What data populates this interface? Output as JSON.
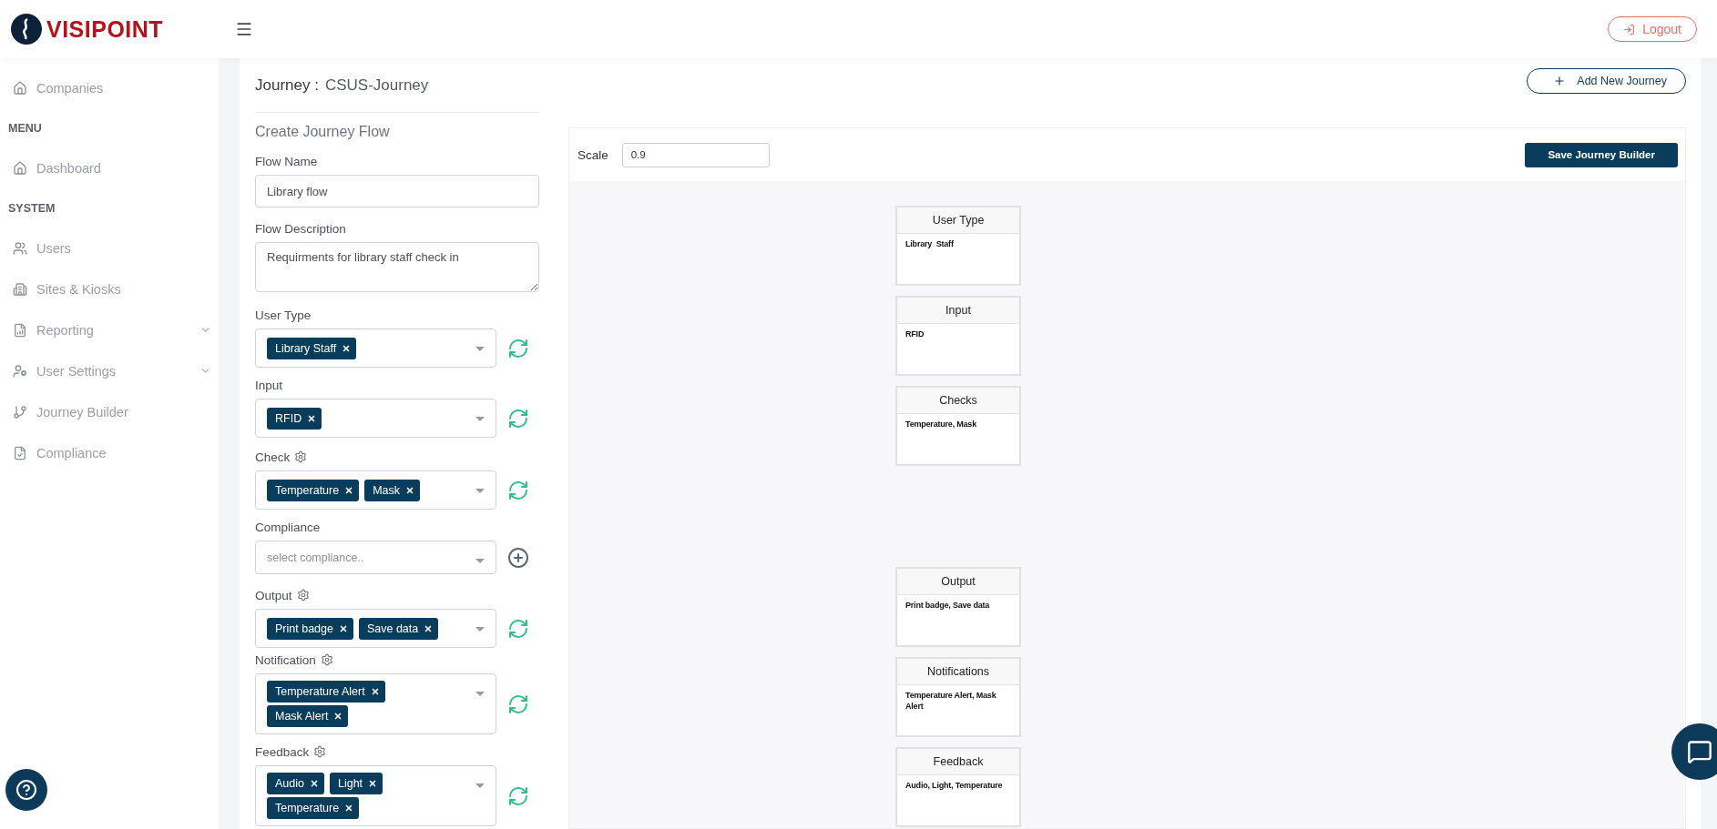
{
  "header": {
    "logo_text": "VISIPOINT",
    "logout": "Logout"
  },
  "sidebar": {
    "items": [
      {
        "kind": "link",
        "label": "Companies"
      },
      {
        "kind": "section",
        "label": "MENU"
      },
      {
        "kind": "link",
        "label": "Dashboard"
      },
      {
        "kind": "section",
        "label": "SYSTEM"
      },
      {
        "kind": "link",
        "label": "Users"
      },
      {
        "kind": "link",
        "label": "Sites & Kiosks"
      },
      {
        "kind": "link",
        "label": "Reporting",
        "expandable": true
      },
      {
        "kind": "link",
        "label": "User Settings",
        "expandable": true
      },
      {
        "kind": "link",
        "label": "Journey Builder"
      },
      {
        "kind": "link",
        "label": "Compliance"
      }
    ]
  },
  "journey": {
    "label": "Journey :",
    "name": "CSUS-Journey",
    "add_button": "Add New Journey"
  },
  "form": {
    "title": "Create Journey Flow",
    "fields": [
      {
        "kind": "text",
        "label": "Flow Name",
        "value": "Library flow"
      },
      {
        "kind": "textarea",
        "label": "Flow Description",
        "value": "Requirments for library staff check in"
      },
      {
        "kind": "multiselect",
        "label": "User Type",
        "tags": [
          "Library Staff"
        ]
      },
      {
        "kind": "multiselect",
        "label": "Input",
        "tags": [
          "RFID"
        ]
      },
      {
        "kind": "multiselect",
        "label": "Check",
        "tags": [
          "Temperature",
          "Mask"
        ],
        "settings": true
      },
      {
        "kind": "select",
        "label": "Compliance",
        "placeholder": "select compliance.."
      },
      {
        "kind": "multiselect",
        "label": "Output",
        "tags": [
          "Print badge",
          "Save data"
        ],
        "settings": true
      },
      {
        "kind": "multiselect",
        "label": "Notification",
        "tags": [
          "Temperature Alert",
          "Mask Alert"
        ],
        "settings": true
      },
      {
        "kind": "multiselect",
        "label": "Feedback",
        "tags": [
          "Audio",
          "Light",
          "Temperature"
        ],
        "settings": true
      }
    ]
  },
  "builder": {
    "scale_label": "Scale",
    "scale_value": "0.9",
    "save_button": "Save Journey Builder",
    "nodes": [
      {
        "title": "User Type",
        "body": "Library  Staff"
      },
      {
        "title": "Input",
        "body": "RFID"
      },
      {
        "title": "Checks",
        "body": "Temperature, Mask"
      },
      {
        "title": "Output",
        "body": "Print badge, Save data"
      },
      {
        "title": "Notifications",
        "body": "Temperature Alert, Mask Alert"
      },
      {
        "title": "Feedback",
        "body": "Audio, Light, Temperature"
      }
    ]
  }
}
